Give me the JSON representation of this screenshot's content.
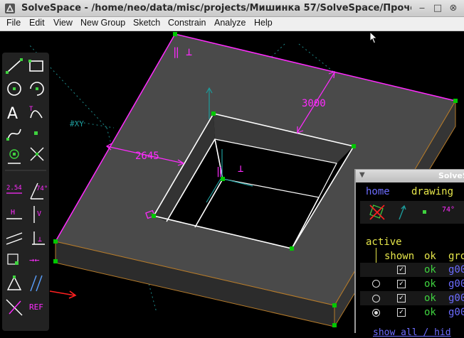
{
  "window": {
    "title": "SolveSpace - /home/neo/data/misc/projects/Мишинка 57/SolveSpace/Прочее/bug-cut/b",
    "minimize": "‒",
    "maximize": "□",
    "close": "⊗"
  },
  "menu": [
    "File",
    "Edit",
    "View",
    "New Group",
    "Sketch",
    "Constrain",
    "Analyze",
    "Help"
  ],
  "viewport": {
    "dim_top": "3000",
    "dim_left": "2645",
    "workplane_label": "#XY",
    "parallel_marks": "‖ ⊥"
  },
  "toolbar": {
    "icons": [
      "line-icon",
      "rectangle-icon",
      "circle-icon",
      "arc-icon",
      "text-icon",
      "tangent-arc-icon",
      "bezier-icon",
      "point-icon",
      "point-on-line-icon",
      "split-curves-icon",
      "distance-dimension-icon",
      "angle-dimension-icon",
      "horizontal-icon",
      "vertical-icon",
      "parallel-icon",
      "perpendicular-icon",
      "on-entity-icon",
      "symmetric-icon",
      "equal-icon",
      "other-supp-angle-icon",
      "construction-icon",
      "reference-icon"
    ],
    "dim_label": "2.54",
    "angle_label": "74°",
    "horiz_label": "H",
    "vert_label": "V",
    "ref_label": "REF"
  },
  "text_window": {
    "title": "SolveSpa",
    "nav_home": "home",
    "nav_drawing": "drawing",
    "angle": "74°",
    "active": "active",
    "col_shown": "shown",
    "col_ok": "ok",
    "col_group": "gro",
    "rows": [
      {
        "radio": "none",
        "shown": "✓",
        "ok": "ok",
        "group": "g00"
      },
      {
        "radio": "empty",
        "shown": "✓",
        "ok": "ok",
        "group": "g00"
      },
      {
        "radio": "empty",
        "shown": "✓",
        "ok": "ok",
        "group": "g00"
      },
      {
        "radio": "selected",
        "shown": "✓",
        "ok": "ok",
        "group": "g00"
      }
    ],
    "footer": "show all / hid"
  },
  "colors": {
    "face": "#4a4a4a",
    "edge": "#ffffff",
    "highlight": "#ff2bff",
    "point": "#00c800",
    "link": "#6c6cff"
  }
}
